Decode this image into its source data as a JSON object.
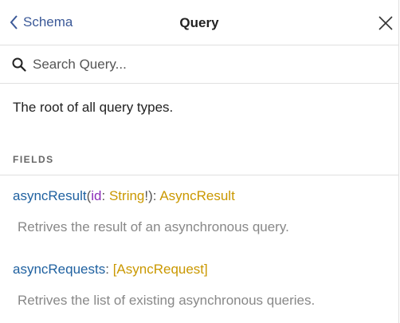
{
  "header": {
    "back_label": "Schema",
    "title": "Query"
  },
  "search": {
    "placeholder": "Search Query..."
  },
  "type_description": "The root of all query types.",
  "fields_section": {
    "label": "FIELDS"
  },
  "fields": [
    {
      "name": "asyncResult",
      "open_paren": "(",
      "arg_name": "id",
      "arg_sep": ": ",
      "arg_type": "String",
      "arg_suffix": "!",
      "close_paren": ")",
      "type_sep": ": ",
      "type": "AsyncResult",
      "description": "Retrives the result of an asynchronous query."
    },
    {
      "name": "asyncRequests",
      "type_sep": ": ",
      "type_open": "[",
      "type": "AsyncRequest",
      "type_close": "]",
      "description": "Retrives the list of existing asynchronous queries."
    }
  ],
  "colors": {
    "field_name": "#1f61a0",
    "arg_name": "#8b2bb9",
    "type_name": "#ca9800",
    "back_link": "#3b5998"
  },
  "icons": {
    "back": "chevron-left-icon",
    "close": "close-icon",
    "search": "search-icon"
  }
}
